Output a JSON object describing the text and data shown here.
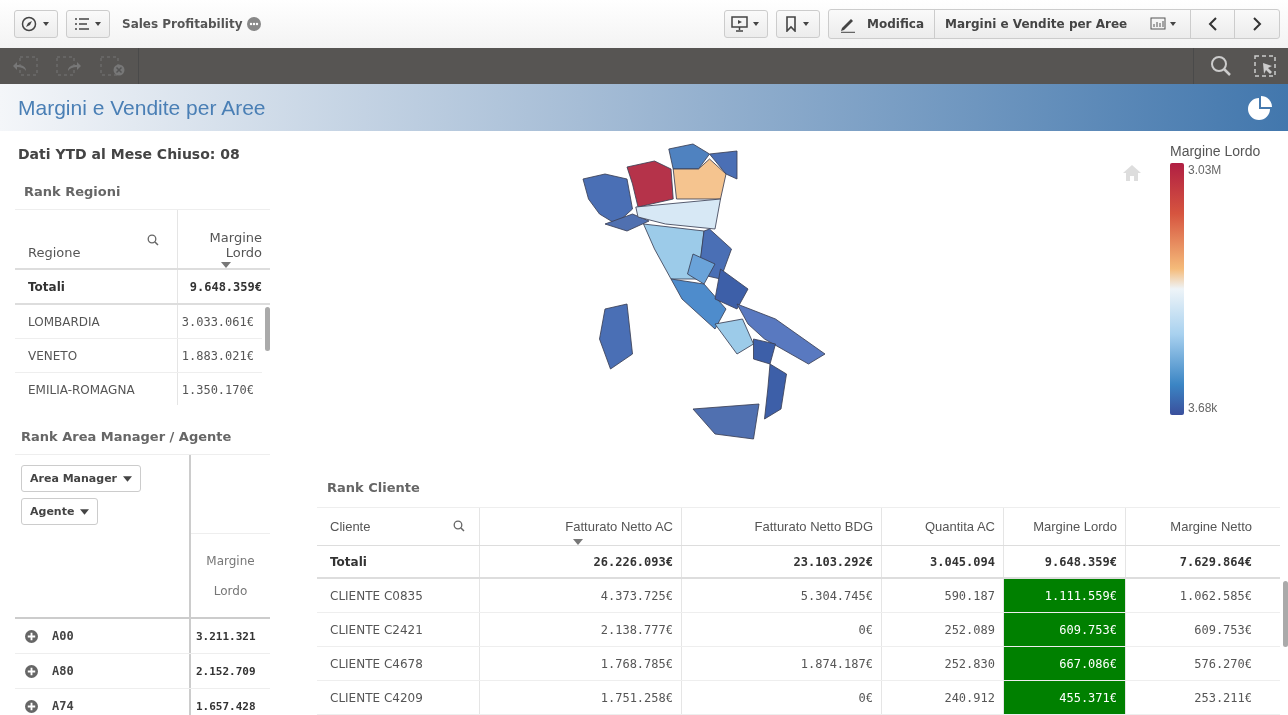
{
  "toolbar": {
    "app_title": "Sales Profitability",
    "edit_button": "Modifica",
    "sheet_selector": "Margini e Vendite per Aree"
  },
  "sheet_title": "Margini e Vendite per Aree",
  "ytd_label": "Dati YTD al Mese Chiuso: 08",
  "rank_regioni": {
    "title": "Rank Regioni",
    "columns": [
      {
        "label": "Regione",
        "searchable": true,
        "sorted": false
      },
      {
        "label": "Margine Lordo",
        "searchable": false,
        "sorted": true
      }
    ],
    "total": [
      "Totali",
      "9.648.359€"
    ],
    "rows": [
      [
        "LOMBARDIA",
        "3.033.061€"
      ],
      [
        "VENETO",
        "1.883.021€"
      ],
      [
        "EMILIA-ROMAGNA",
        "1.350.170€"
      ]
    ]
  },
  "rank_agente": {
    "title": "Rank Area Manager / Agente",
    "dimension_buttons": [
      "Area Manager",
      "Agente"
    ],
    "measure": "Margine Lordo",
    "rows": [
      {
        "code": "A00",
        "value": "3.211.321"
      },
      {
        "code": "A80",
        "value": "2.152.709"
      },
      {
        "code": "A74",
        "value": "1.657.428"
      }
    ]
  },
  "map_legend": {
    "title": "Margine Lordo",
    "max": "3.03M",
    "min": "3.68k"
  },
  "rank_cliente": {
    "title": "Rank Cliente",
    "columns": [
      {
        "label": "Cliente",
        "searchable": true,
        "sorted": false,
        "highlight": false
      },
      {
        "label": "Fatturato Netto AC",
        "searchable": false,
        "sorted": true,
        "highlight": false
      },
      {
        "label": "Fatturato Netto BDG",
        "searchable": false,
        "sorted": false,
        "highlight": false
      },
      {
        "label": "Quantita AC",
        "searchable": false,
        "sorted": false,
        "highlight": false
      },
      {
        "label": "Margine Lordo",
        "searchable": false,
        "sorted": false,
        "highlight": true
      },
      {
        "label": "Margine Netto",
        "searchable": false,
        "sorted": false,
        "highlight": false
      }
    ],
    "total": [
      "Totali",
      "26.226.093€",
      "23.103.292€",
      "3.045.094",
      "9.648.359€",
      "7.629.864€"
    ],
    "rows": [
      [
        "CLIENTE C0835",
        "4.373.725€",
        "5.304.745€",
        "590.187",
        "1.111.559€",
        "1.062.585€"
      ],
      [
        "CLIENTE C2421",
        "2.138.777€",
        "0€",
        "252.089",
        "609.753€",
        "609.753€"
      ],
      [
        "CLIENTE C4678",
        "1.768.785€",
        "1.874.187€",
        "252.830",
        "667.086€",
        "576.270€"
      ],
      [
        "CLIENTE C4209",
        "1.751.258€",
        "0€",
        "240.912",
        "455.371€",
        "253.211€"
      ]
    ]
  }
}
